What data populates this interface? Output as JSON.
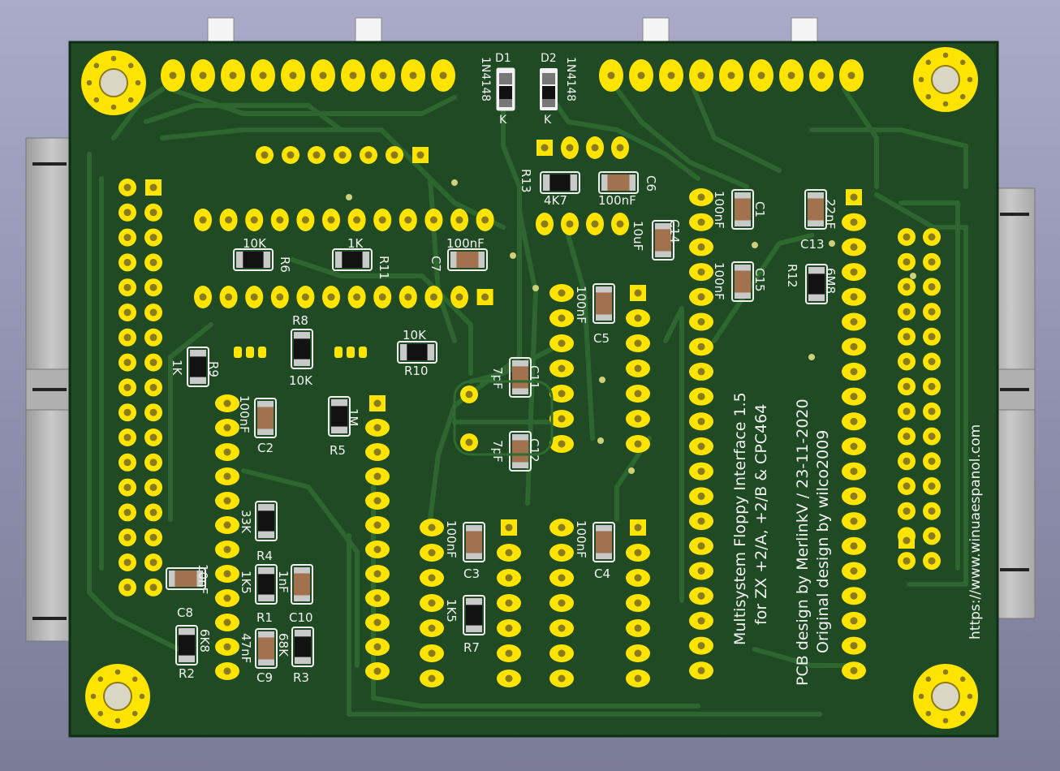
{
  "board": {
    "colors": {
      "background_top": "#a9abc9",
      "soldermask": "#1f4a24",
      "copper_trace": "#2f6b31",
      "pad": "#ffe400",
      "pad_hole": "#8b7b1a",
      "silkscreen": "#f2f2f2",
      "connector": "#b7b7b7"
    },
    "components": {
      "D1": {
        "ref": "D1",
        "value": "1N4148",
        "pin": "K"
      },
      "D2": {
        "ref": "D2",
        "value": "1N4148",
        "pin": "K"
      },
      "R13": {
        "ref": "R13",
        "value": "4K7"
      },
      "C6": {
        "ref": "C6",
        "value": "100nF"
      },
      "C14": {
        "ref": "C14",
        "value": "10uF"
      },
      "C1": {
        "ref": "C1",
        "value": "100nF"
      },
      "C13": {
        "ref": "C13",
        "value": "22nF"
      },
      "R12": {
        "ref": "R12",
        "value": "6M8"
      },
      "C15": {
        "ref": "C15",
        "value": "100nF"
      },
      "R6": {
        "ref": "R6",
        "value": "10K"
      },
      "R11": {
        "ref": "R11",
        "value": "1K"
      },
      "C7": {
        "ref": "C7",
        "value": "100nF"
      },
      "C5": {
        "ref": "C5",
        "value": "100nF"
      },
      "R8": {
        "ref": "R8",
        "value": "10K"
      },
      "R10": {
        "ref": "R10",
        "value": "10K"
      },
      "R9": {
        "ref": "R9",
        "value": "1K"
      },
      "C11": {
        "ref": "C11",
        "value": "7pF"
      },
      "C12": {
        "ref": "C12",
        "value": "7pF"
      },
      "C2": {
        "ref": "C2",
        "value": "100nF"
      },
      "R5": {
        "ref": "R5",
        "value": "1M"
      },
      "R4": {
        "ref": "R4",
        "value": "33K"
      },
      "C3": {
        "ref": "C3",
        "value": "100nF"
      },
      "C4": {
        "ref": "C4",
        "value": "100nF"
      },
      "R1": {
        "ref": "R1",
        "value": "1K5"
      },
      "C10": {
        "ref": "C10",
        "value": "1nF"
      },
      "C8": {
        "ref": "C8",
        "value": "10nF"
      },
      "R7": {
        "ref": "R7",
        "value": "1K5"
      },
      "R2": {
        "ref": "R2",
        "value": "6K8"
      },
      "C9": {
        "ref": "C9",
        "value": "47nF"
      },
      "R3": {
        "ref": "R3",
        "value": "68K"
      }
    },
    "titles": {
      "title_line1": "Multisystem Floppy Interface 1.5",
      "title_line2": "for ZX +2/A, +2/B & CPC464",
      "credit_line1": "PCB design by MerlinkV / 23-11-2020",
      "credit_line2": "Original design by wilco2009",
      "url": "https://www.winuaespanol.com"
    }
  }
}
